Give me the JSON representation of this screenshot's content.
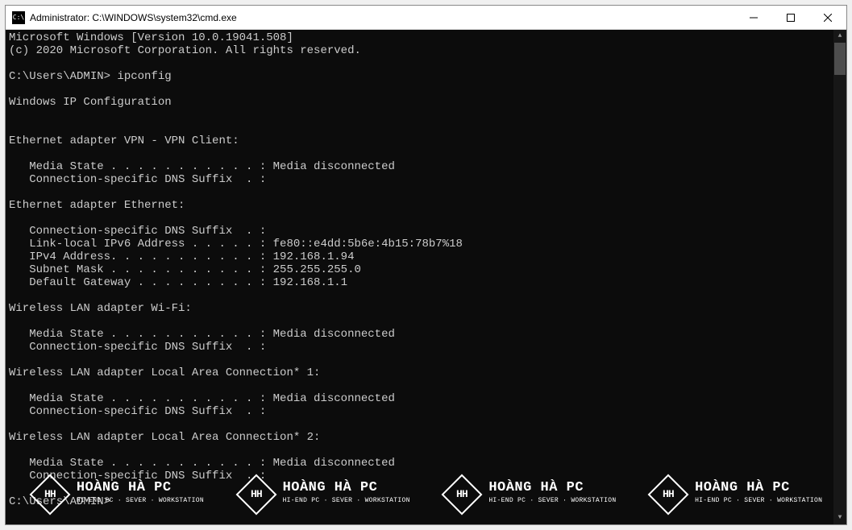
{
  "window": {
    "title": "Administrator: C:\\WINDOWS\\system32\\cmd.exe",
    "icon_text": "C:\\"
  },
  "terminal": {
    "header_line1": "Microsoft Windows [Version 10.0.19041.508]",
    "header_line2": "(c) 2020 Microsoft Corporation. All rights reserved.",
    "prompt1": "C:\\Users\\ADMIN> ipconfig",
    "config_title": "Windows IP Configuration",
    "adapters": [
      {
        "name": "Ethernet adapter VPN - VPN Client:",
        "lines": [
          "   Media State . . . . . . . . . . . : Media disconnected",
          "   Connection-specific DNS Suffix  . :"
        ]
      },
      {
        "name": "Ethernet adapter Ethernet:",
        "lines": [
          "   Connection-specific DNS Suffix  . :",
          "   Link-local IPv6 Address . . . . . : fe80::e4dd:5b6e:4b15:78b7%18",
          "   IPv4 Address. . . . . . . . . . . : 192.168.1.94",
          "   Subnet Mask . . . . . . . . . . . : 255.255.255.0",
          "   Default Gateway . . . . . . . . . : 192.168.1.1"
        ]
      },
      {
        "name": "Wireless LAN adapter Wi-Fi:",
        "lines": [
          "   Media State . . . . . . . . . . . : Media disconnected",
          "   Connection-specific DNS Suffix  . :"
        ]
      },
      {
        "name": "Wireless LAN adapter Local Area Connection* 1:",
        "lines": [
          "   Media State . . . . . . . . . . . : Media disconnected",
          "   Connection-specific DNS Suffix  . :"
        ]
      },
      {
        "name": "Wireless LAN adapter Local Area Connection* 2:",
        "lines": [
          "   Media State . . . . . . . . . . . : Media disconnected",
          "   Connection-specific DNS Suffix  . :"
        ]
      }
    ],
    "prompt2": "C:\\Users\\ADMIN>"
  },
  "watermark": {
    "logo_text": "HH",
    "title": "HOÀNG HÀ PC",
    "subtitle": "HI-END PC · SEVER · WORKSTATION"
  }
}
